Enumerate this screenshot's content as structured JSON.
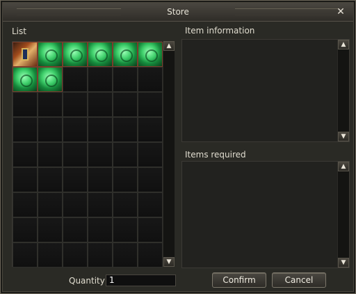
{
  "window": {
    "title": "Store",
    "close_symbol": "✕"
  },
  "list": {
    "label": "List",
    "items": [
      {
        "icon": "banner-icon"
      },
      {
        "icon": "green-scroll-icon"
      },
      {
        "icon": "green-scroll-icon"
      },
      {
        "icon": "green-scroll-icon"
      },
      {
        "icon": "green-scroll-icon"
      },
      {
        "icon": "green-scroll-icon"
      },
      {
        "icon": "green-scroll-icon"
      },
      {
        "icon": "green-scroll-icon"
      }
    ]
  },
  "item_information": {
    "label": "Item information"
  },
  "items_required": {
    "label": "Items required"
  },
  "quantity": {
    "label": "Quantity",
    "value": "1"
  },
  "buttons": {
    "confirm": "Confirm",
    "cancel": "Cancel"
  },
  "scroll": {
    "up_symbol": "▲",
    "down_symbol": "▼"
  }
}
